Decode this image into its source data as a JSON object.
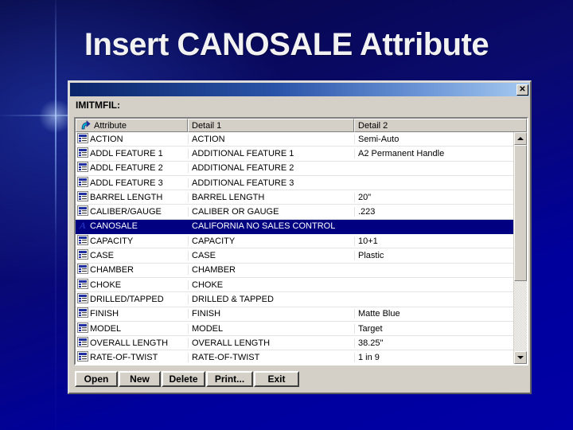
{
  "slide": {
    "title": "Insert CANOSALE Attribute",
    "background_color": "#00008f"
  },
  "window": {
    "close_label": "✕",
    "file_label": "IMITMFIL:",
    "titlebar_gradient_start": "#0a246a",
    "titlebar_gradient_end": "#a6caf0",
    "selection_color": "#000080"
  },
  "list": {
    "sort_icon": "sort-arrow-icon",
    "columns": [
      {
        "label": "Attribute"
      },
      {
        "label": "Detail 1"
      },
      {
        "label": "Detail 2"
      }
    ],
    "rows": [
      {
        "icon": "record-icon",
        "attribute": "ACTION",
        "detail1": "ACTION",
        "detail2": "Semi-Auto",
        "selected": false
      },
      {
        "icon": "record-icon",
        "attribute": "ADDL FEATURE 1",
        "detail1": "ADDITIONAL FEATURE 1",
        "detail2": "A2 Permanent Handle",
        "selected": false
      },
      {
        "icon": "record-icon",
        "attribute": "ADDL FEATURE 2",
        "detail1": "ADDITIONAL FEATURE 2",
        "detail2": "",
        "selected": false
      },
      {
        "icon": "record-icon",
        "attribute": "ADDL FEATURE 3",
        "detail1": "ADDITIONAL FEATURE 3",
        "detail2": "",
        "selected": false
      },
      {
        "icon": "record-icon",
        "attribute": "BARREL LENGTH",
        "detail1": "BARREL LENGTH",
        "detail2": "20\"",
        "selected": false
      },
      {
        "icon": "record-icon",
        "attribute": "CALIBER/GAUGE",
        "detail1": "CALIBER OR GAUGE",
        "detail2": ".223",
        "selected": false
      },
      {
        "icon": "text-a-icon",
        "attribute": "CANOSALE",
        "detail1": "CALIFORNIA NO SALES CONTROL",
        "detail2": "",
        "selected": true
      },
      {
        "icon": "record-icon",
        "attribute": "CAPACITY",
        "detail1": "CAPACITY",
        "detail2": "10+1",
        "selected": false
      },
      {
        "icon": "record-icon",
        "attribute": "CASE",
        "detail1": "CASE",
        "detail2": "Plastic",
        "selected": false
      },
      {
        "icon": "record-icon",
        "attribute": "CHAMBER",
        "detail1": "CHAMBER",
        "detail2": "",
        "selected": false
      },
      {
        "icon": "record-icon",
        "attribute": "CHOKE",
        "detail1": "CHOKE",
        "detail2": "",
        "selected": false
      },
      {
        "icon": "record-icon",
        "attribute": "DRILLED/TAPPED",
        "detail1": "DRILLED & TAPPED",
        "detail2": "",
        "selected": false
      },
      {
        "icon": "record-icon",
        "attribute": "FINISH",
        "detail1": "FINISH",
        "detail2": "Matte Blue",
        "selected": false
      },
      {
        "icon": "record-icon",
        "attribute": "MODEL",
        "detail1": "MODEL",
        "detail2": "Target",
        "selected": false
      },
      {
        "icon": "record-icon",
        "attribute": "OVERALL LENGTH",
        "detail1": "OVERALL LENGTH",
        "detail2": "38.25\"",
        "selected": false
      },
      {
        "icon": "record-icon",
        "attribute": "RATE-OF-TWIST",
        "detail1": "RATE-OF-TWIST",
        "detail2": "1 in 9",
        "selected": false
      }
    ],
    "scrollbar": {
      "up_icon": "scroll-up-arrow-icon",
      "down_icon": "scroll-down-arrow-icon",
      "thumb_fraction": 0.66
    }
  },
  "buttons": [
    {
      "label": "Open",
      "name": "open-button",
      "cls": "b-open"
    },
    {
      "label": "New",
      "name": "new-button",
      "cls": "b-new"
    },
    {
      "label": "Delete",
      "name": "delete-button",
      "cls": "b-del"
    },
    {
      "label": "Print...",
      "name": "print-button",
      "cls": "b-print"
    },
    {
      "label": "Exit",
      "name": "exit-button",
      "cls": "b-exit"
    }
  ]
}
